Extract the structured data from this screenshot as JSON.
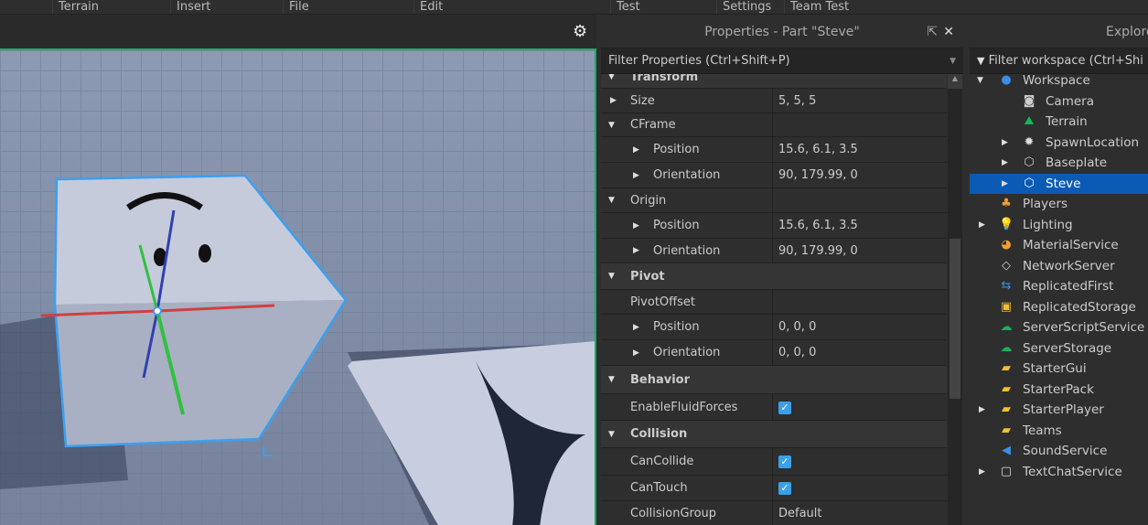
{
  "menu": [
    "Terrain",
    "Insert",
    "File",
    "Edit",
    "Test",
    "Settings",
    "Team Test"
  ],
  "properties": {
    "title": "Properties - Part \"Steve\"",
    "filter_placeholder": "Filter Properties (Ctrl+Shift+P)",
    "rows": [
      {
        "name": "Transform",
        "type": "cat",
        "expanded": true
      },
      {
        "name": "Size",
        "value": "5, 5, 5",
        "level": 0,
        "expander": "collapsed"
      },
      {
        "name": "CFrame",
        "value": "",
        "level": 0,
        "expander": "expanded"
      },
      {
        "name": "Position",
        "value": "15.6, 6.1, 3.5",
        "level": 1,
        "expander": "collapsed"
      },
      {
        "name": "Orientation",
        "value": "90, 179.99, 0",
        "level": 1,
        "expander": "collapsed"
      },
      {
        "name": "Origin",
        "value": "",
        "level": 0,
        "expander": "expanded"
      },
      {
        "name": "Position",
        "value": "15.6, 6.1, 3.5",
        "level": 1,
        "expander": "collapsed"
      },
      {
        "name": "Orientation",
        "value": "90, 179.99, 0",
        "level": 1,
        "expander": "collapsed"
      },
      {
        "name": "Pivot",
        "type": "cat",
        "expanded": true
      },
      {
        "name": "PivotOffset",
        "value": "",
        "level": 0,
        "expander": "none"
      },
      {
        "name": "Position",
        "value": "0, 0, 0",
        "level": 1,
        "expander": "collapsed"
      },
      {
        "name": "Orientation",
        "value": "0, 0, 0",
        "level": 1,
        "expander": "collapsed"
      },
      {
        "name": "Behavior",
        "type": "cat",
        "expanded": true
      },
      {
        "name": "EnableFluidForces",
        "value": "",
        "checked": true,
        "level": 0,
        "expander": "none"
      },
      {
        "name": "Collision",
        "type": "cat",
        "expanded": true
      },
      {
        "name": "CanCollide",
        "value": "",
        "checked": true,
        "level": 0,
        "expander": "none"
      },
      {
        "name": "CanTouch",
        "value": "",
        "checked": true,
        "level": 0,
        "expander": "none"
      },
      {
        "name": "CollisionGroup",
        "value": "Default",
        "level": 0,
        "expander": "none"
      }
    ]
  },
  "explorer": {
    "title": "Explore",
    "filter_placeholder": "Filter workspace (Ctrl+Shi",
    "items": [
      {
        "name": "Workspace",
        "level": 0,
        "expander": "expanded",
        "icon": "globe-icon",
        "color": "#3a8ee6"
      },
      {
        "name": "Camera",
        "level": 1,
        "expander": "none",
        "icon": "camera-icon",
        "color": "#ccc"
      },
      {
        "name": "Terrain",
        "level": 1,
        "expander": "none",
        "icon": "terrain-icon",
        "color": "#19b35a"
      },
      {
        "name": "SpawnLocation",
        "level": 1,
        "expander": "collapsed",
        "icon": "spawn-icon",
        "color": "#ddd"
      },
      {
        "name": "Baseplate",
        "level": 1,
        "expander": "collapsed",
        "icon": "part-icon",
        "color": "#ccc"
      },
      {
        "name": "Steve",
        "level": 1,
        "expander": "collapsed",
        "icon": "part-icon",
        "color": "#fff",
        "selected": true
      },
      {
        "name": "Players",
        "level": 0,
        "expander": "none",
        "icon": "players-icon",
        "color": "#f0a030"
      },
      {
        "name": "Lighting",
        "level": 0,
        "expander": "collapsed",
        "icon": "lightbulb-icon",
        "color": "#f5e030"
      },
      {
        "name": "MaterialService",
        "level": 0,
        "expander": "none",
        "icon": "material-icon",
        "color": "#f0a030"
      },
      {
        "name": "NetworkServer",
        "level": 0,
        "expander": "none",
        "icon": "diamond-icon",
        "color": "#ccc"
      },
      {
        "name": "ReplicatedFirst",
        "level": 0,
        "expander": "none",
        "icon": "replicated-first-icon",
        "color": "#3a8ee6"
      },
      {
        "name": "ReplicatedStorage",
        "level": 0,
        "expander": "none",
        "icon": "replicated-storage-icon",
        "color": "#f0c030"
      },
      {
        "name": "ServerScriptService",
        "level": 0,
        "expander": "none",
        "icon": "server-script-icon",
        "color": "#19b35a"
      },
      {
        "name": "ServerStorage",
        "level": 0,
        "expander": "none",
        "icon": "server-storage-icon",
        "color": "#19b35a"
      },
      {
        "name": "StarterGui",
        "level": 0,
        "expander": "none",
        "icon": "folder-icon",
        "color": "#f0c030"
      },
      {
        "name": "StarterPack",
        "level": 0,
        "expander": "none",
        "icon": "folder-icon",
        "color": "#f0c030"
      },
      {
        "name": "StarterPlayer",
        "level": 0,
        "expander": "collapsed",
        "icon": "folder-user-icon",
        "color": "#f0c030"
      },
      {
        "name": "Teams",
        "level": 0,
        "expander": "none",
        "icon": "teams-icon",
        "color": "#f0c030"
      },
      {
        "name": "SoundService",
        "level": 0,
        "expander": "none",
        "icon": "speaker-icon",
        "color": "#3a8ee6"
      },
      {
        "name": "TextChatService",
        "level": 0,
        "expander": "collapsed",
        "icon": "chat-icon",
        "color": "#ddd"
      }
    ]
  },
  "colors": {
    "selection": "#0b5bb5",
    "viewport_border": "#13b15c",
    "check": "#3ca0e8"
  }
}
